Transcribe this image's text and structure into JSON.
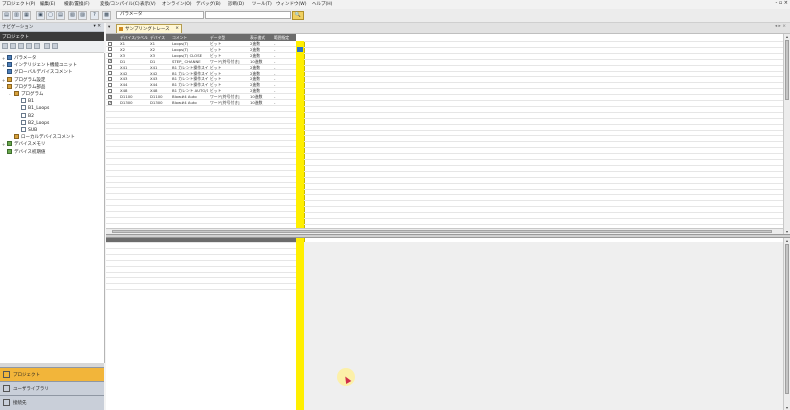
{
  "menu": [
    "プロジェクト(P)",
    "編集(E)",
    "検索/置換(F)",
    "変換/コンパイル(C)",
    "表示(V)",
    "オンライン(O)",
    "デバッグ(B)",
    "診断(D)",
    "ツール(T)",
    "ウィンドウ(W)",
    "ヘルプ(H)"
  ],
  "window_controls": "- ▫ ×",
  "toolbar": {
    "field_value": "パラメータ",
    "search_glyph": "🔍"
  },
  "nav": {
    "header": "ナビゲーション",
    "pin": "▾ ✕",
    "project_header": "プロジェクト",
    "tree": [
      {
        "label": "パラメータ",
        "indent": 0,
        "icon": "b",
        "exp": "+"
      },
      {
        "label": "インテリジェント機能ユニット",
        "indent": 0,
        "icon": "b",
        "exp": "+"
      },
      {
        "label": "グローバルデバイスコメント",
        "indent": 0,
        "icon": "b",
        "exp": ""
      },
      {
        "label": "プログラム設定",
        "indent": 0,
        "icon": "y",
        "exp": "+"
      },
      {
        "label": "プログラム部品",
        "indent": 0,
        "icon": "y",
        "exp": "-"
      },
      {
        "label": "プログラム",
        "indent": 1,
        "icon": "y",
        "exp": "-"
      },
      {
        "label": "B1",
        "indent": 2,
        "icon": "w",
        "exp": ""
      },
      {
        "label": "B1_Loops",
        "indent": 2,
        "icon": "w",
        "exp": ""
      },
      {
        "label": "B2",
        "indent": 2,
        "icon": "w",
        "exp": ""
      },
      {
        "label": "B2_Loops",
        "indent": 2,
        "icon": "w",
        "exp": ""
      },
      {
        "label": "SUB",
        "indent": 2,
        "icon": "w",
        "exp": ""
      },
      {
        "label": "ローカルデバイスコメント",
        "indent": 1,
        "icon": "y",
        "exp": ""
      },
      {
        "label": "デバイスメモリ",
        "indent": 0,
        "icon": "g",
        "exp": "+"
      },
      {
        "label": "デバイス初期値",
        "indent": 0,
        "icon": "g",
        "exp": ""
      }
    ],
    "buttons": [
      "プロジェクト",
      "ユーザライブラリ",
      "接続先"
    ]
  },
  "tab": {
    "label": "サンプリングトレース",
    "close": "×"
  },
  "tabstrip_right": "◂ ▸ ×",
  "grid": {
    "headers": [
      "",
      "デバイス/ラベル",
      "デバイス",
      "コメント",
      "データ型",
      "表示書式",
      "範囲指定"
    ],
    "rows": [
      {
        "chk": false,
        "label": "X1",
        "dev": "X1",
        "comment": "Loops(T)",
        "type": "ビット",
        "fmt": "2進数",
        "range": "-"
      },
      {
        "chk": false,
        "label": "X2",
        "dev": "X2",
        "comment": "Loops(T)",
        "type": "ビット",
        "fmt": "2進数",
        "range": "-"
      },
      {
        "chk": false,
        "label": "X3",
        "dev": "X3",
        "comment": "Loops(T) CLOSE",
        "type": "ビット",
        "fmt": "2進数",
        "range": "-"
      },
      {
        "chk": true,
        "label": "D1",
        "dev": "D1",
        "comment": "STEP_ CHANNE",
        "type": "ワード[符号付き]",
        "fmt": "10進数",
        "range": "-"
      },
      {
        "chk": false,
        "label": "X41",
        "dev": "X41",
        "comment": "B1 カレント操作スイッチ",
        "type": "ビット",
        "fmt": "2進数",
        "range": "-"
      },
      {
        "chk": false,
        "label": "X42",
        "dev": "X42",
        "comment": "B1 カレント操作スイッチ",
        "type": "ビット",
        "fmt": "2進数",
        "range": "-"
      },
      {
        "chk": false,
        "label": "X43",
        "dev": "X43",
        "comment": "B1 カレント操作スイッチ",
        "type": "ビット",
        "fmt": "2進数",
        "range": "-"
      },
      {
        "chk": false,
        "label": "X44",
        "dev": "X44",
        "comment": "B1 カレント操作スイッチ",
        "type": "ビット",
        "fmt": "2進数",
        "range": "-"
      },
      {
        "chk": false,
        "label": "X48",
        "dev": "X48",
        "comment": "B1 カレント AUTO/1",
        "type": "ビット",
        "fmt": "2進数",
        "range": "-"
      },
      {
        "chk": true,
        "label": "D1100",
        "dev": "D1100",
        "comment": "Blow#4 Auto",
        "type": "ワード[符号付き]",
        "fmt": "10進数",
        "range": "-"
      },
      {
        "chk": true,
        "label": "D1300",
        "dev": "D1300",
        "comment": "Blow#4 Auto",
        "type": "ワード[符号付き]",
        "fmt": "10進数",
        "range": "-"
      }
    ]
  },
  "scroll": {
    "up": "▴",
    "down": "▾"
  },
  "colors": {
    "accent_yellow": "#ffef00",
    "nav_active": "#f2b53a",
    "cell_blue": "#2d73c8"
  }
}
